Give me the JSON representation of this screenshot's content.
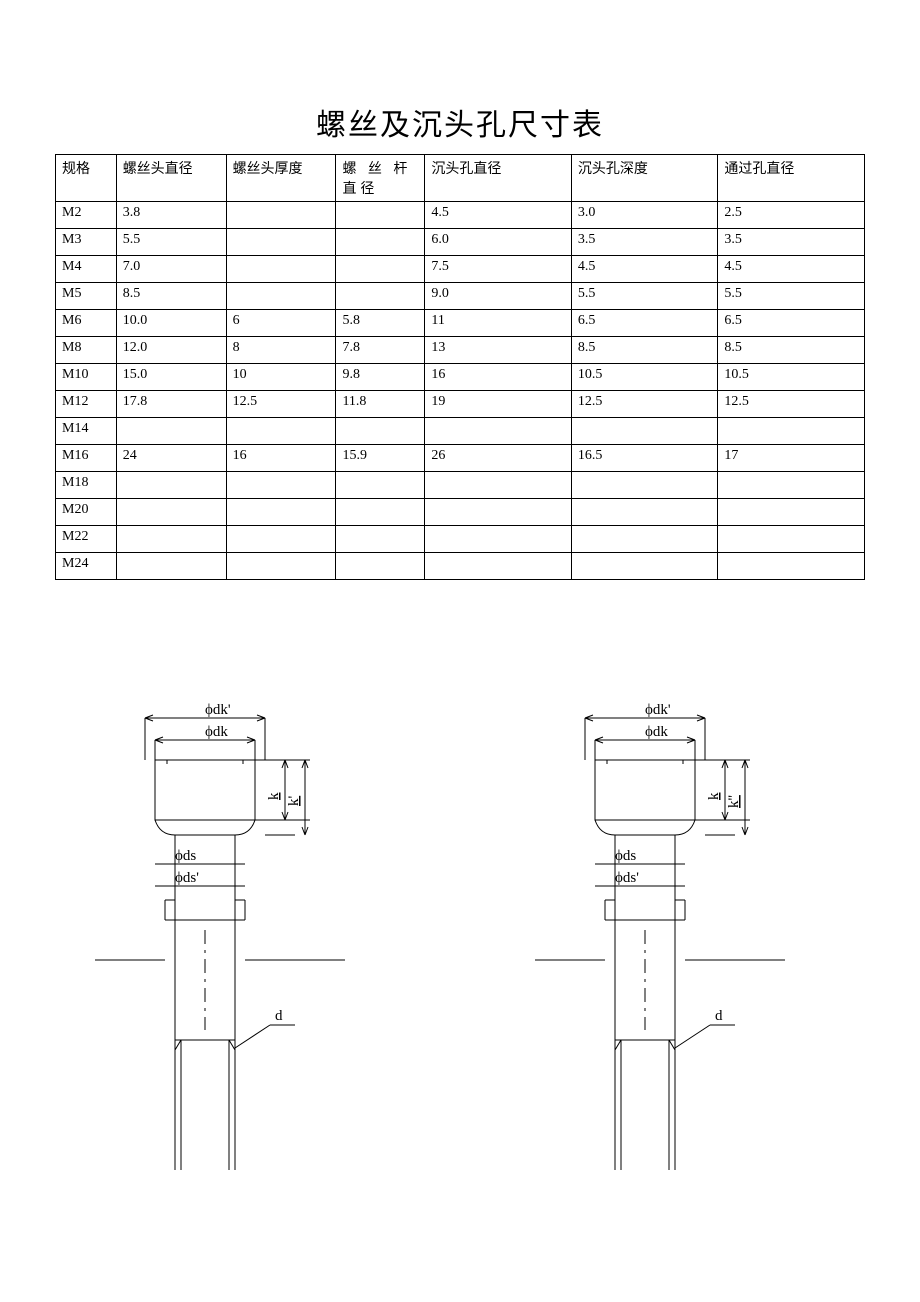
{
  "title": "螺丝及沉头孔尺寸表",
  "columns": [
    "规格",
    "螺丝头直径",
    "螺丝头厚度",
    "螺 丝 杆 直径",
    "沉头孔直径",
    "沉头孔深度",
    "通过孔直径"
  ],
  "rows": [
    {
      "spec": "M2",
      "headDia": "3.8",
      "headThk": "",
      "shank": "",
      "cbDia": "4.5",
      "cbDepth": "3.0",
      "thru": "2.5"
    },
    {
      "spec": "M3",
      "headDia": "5.5",
      "headThk": "",
      "shank": "",
      "cbDia": "6.0",
      "cbDepth": "3.5",
      "thru": "3.5"
    },
    {
      "spec": "M4",
      "headDia": "7.0",
      "headThk": "",
      "shank": "",
      "cbDia": "7.5",
      "cbDepth": "4.5",
      "thru": "4.5"
    },
    {
      "spec": "M5",
      "headDia": "8.5",
      "headThk": "",
      "shank": "",
      "cbDia": "9.0",
      "cbDepth": "5.5",
      "thru": "5.5"
    },
    {
      "spec": "M6",
      "headDia": "10.0",
      "headThk": "6",
      "shank": "5.8",
      "cbDia": "11",
      "cbDepth": "6.5",
      "thru": "6.5"
    },
    {
      "spec": "M8",
      "headDia": "12.0",
      "headThk": "8",
      "shank": "7.8",
      "cbDia": "13",
      "cbDepth": "8.5",
      "thru": "8.5"
    },
    {
      "spec": "M10",
      "headDia": "15.0",
      "headThk": "10",
      "shank": "9.8",
      "cbDia": "16",
      "cbDepth": "10.5",
      "thru": "10.5"
    },
    {
      "spec": "M12",
      "headDia": "17.8",
      "headThk": "12.5",
      "shank": "11.8",
      "cbDia": "19",
      "cbDepth": "12.5",
      "thru": "12.5"
    },
    {
      "spec": "M14",
      "headDia": "",
      "headThk": "",
      "shank": "",
      "cbDia": "",
      "cbDepth": "",
      "thru": ""
    },
    {
      "spec": "M16",
      "headDia": "24",
      "headThk": "16",
      "shank": "15.9",
      "cbDia": "26",
      "cbDepth": "16.5",
      "thru": "17"
    },
    {
      "spec": "M18",
      "headDia": "",
      "headThk": "",
      "shank": "",
      "cbDia": "",
      "cbDepth": "",
      "thru": ""
    },
    {
      "spec": "M20",
      "headDia": "",
      "headThk": "",
      "shank": "",
      "cbDia": "",
      "cbDepth": "",
      "thru": ""
    },
    {
      "spec": "M22",
      "headDia": "",
      "headThk": "",
      "shank": "",
      "cbDia": "",
      "cbDepth": "",
      "thru": ""
    },
    {
      "spec": "M24",
      "headDia": "",
      "headThk": "",
      "shank": "",
      "cbDia": "",
      "cbDepth": "",
      "thru": ""
    }
  ],
  "diagramLabels": {
    "phidkprime": "ϕdk'",
    "phidk": "ϕdk",
    "k": "k",
    "kprime": "k'",
    "kdprime": "k''",
    "phids": "ϕds",
    "phidsprime": "ϕds'",
    "d": "d"
  }
}
